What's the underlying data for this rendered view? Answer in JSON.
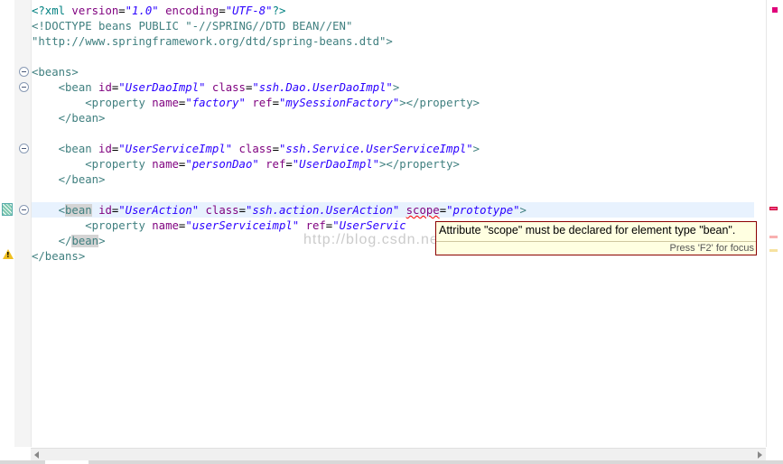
{
  "editor": {
    "lines": [
      {
        "parts": [
          {
            "c": "t-decl",
            "t": "<?xml "
          },
          {
            "c": "t-attr",
            "t": "version"
          },
          {
            "c": "",
            "t": "="
          },
          {
            "c": "t-str",
            "t": "\"1.0\""
          },
          {
            "c": "",
            "t": " "
          },
          {
            "c": "t-attr",
            "t": "encoding"
          },
          {
            "c": "",
            "t": "="
          },
          {
            "c": "t-str",
            "t": "\"UTF-8\""
          },
          {
            "c": "t-decl",
            "t": "?>"
          }
        ]
      },
      {
        "parts": [
          {
            "c": "t-doc",
            "t": "<!DOCTYPE beans PUBLIC \"-//SPRING//DTD BEAN//EN\""
          }
        ]
      },
      {
        "parts": [
          {
            "c": "t-doc",
            "t": "\"http://www.springframework.org/dtd/spring-beans.dtd\">"
          }
        ]
      },
      {
        "parts": []
      },
      {
        "parts": [
          {
            "c": "t-tag",
            "t": "<beans>"
          }
        ]
      },
      {
        "parts": [
          {
            "c": "",
            "t": "    "
          },
          {
            "c": "t-tag",
            "t": "<bean "
          },
          {
            "c": "t-attr",
            "t": "id"
          },
          {
            "c": "",
            "t": "="
          },
          {
            "c": "t-str",
            "t": "\"UserDaoImpl\""
          },
          {
            "c": "",
            "t": " "
          },
          {
            "c": "t-attr",
            "t": "class"
          },
          {
            "c": "",
            "t": "="
          },
          {
            "c": "t-str",
            "t": "\"ssh.Dao.UserDaoImpl\""
          },
          {
            "c": "t-tag",
            "t": ">"
          }
        ]
      },
      {
        "parts": [
          {
            "c": "",
            "t": "        "
          },
          {
            "c": "t-tag",
            "t": "<property "
          },
          {
            "c": "t-attr",
            "t": "name"
          },
          {
            "c": "",
            "t": "="
          },
          {
            "c": "t-str",
            "t": "\"factory\""
          },
          {
            "c": "",
            "t": " "
          },
          {
            "c": "t-attr",
            "t": "ref"
          },
          {
            "c": "",
            "t": "="
          },
          {
            "c": "t-str",
            "t": "\"mySessionFactory\""
          },
          {
            "c": "t-tag",
            "t": "></property>"
          }
        ]
      },
      {
        "parts": [
          {
            "c": "",
            "t": "    "
          },
          {
            "c": "t-tag",
            "t": "</bean>"
          }
        ]
      },
      {
        "parts": []
      },
      {
        "parts": [
          {
            "c": "",
            "t": "    "
          },
          {
            "c": "t-tag",
            "t": "<bean "
          },
          {
            "c": "t-attr",
            "t": "id"
          },
          {
            "c": "",
            "t": "="
          },
          {
            "c": "t-str",
            "t": "\"UserServiceImpl\""
          },
          {
            "c": "",
            "t": " "
          },
          {
            "c": "t-attr",
            "t": "class"
          },
          {
            "c": "",
            "t": "="
          },
          {
            "c": "t-str",
            "t": "\"ssh.Service.UserServiceImpl\""
          },
          {
            "c": "t-tag",
            "t": ">"
          }
        ]
      },
      {
        "parts": [
          {
            "c": "",
            "t": "        "
          },
          {
            "c": "t-tag",
            "t": "<property "
          },
          {
            "c": "t-attr",
            "t": "name"
          },
          {
            "c": "",
            "t": "="
          },
          {
            "c": "t-str",
            "t": "\"personDao\""
          },
          {
            "c": "",
            "t": " "
          },
          {
            "c": "t-attr",
            "t": "ref"
          },
          {
            "c": "",
            "t": "="
          },
          {
            "c": "t-str",
            "t": "\"UserDaoImpl\""
          },
          {
            "c": "t-tag",
            "t": "></property>"
          }
        ]
      },
      {
        "parts": [
          {
            "c": "",
            "t": "    "
          },
          {
            "c": "t-tag",
            "t": "</bean>"
          }
        ]
      },
      {
        "parts": []
      },
      {
        "parts": [
          {
            "c": "",
            "t": "    "
          },
          {
            "c": "t-tag",
            "t": "<"
          },
          {
            "c": "t-tag match",
            "t": "bean"
          },
          {
            "c": "",
            "t": " "
          },
          {
            "c": "t-attr",
            "t": "id"
          },
          {
            "c": "",
            "t": "="
          },
          {
            "c": "t-str",
            "t": "\"UserAction\""
          },
          {
            "c": "",
            "t": " "
          },
          {
            "c": "t-attr",
            "t": "class"
          },
          {
            "c": "",
            "t": "="
          },
          {
            "c": "t-str",
            "t": "\"ssh.action.UserAction\""
          },
          {
            "c": "",
            "t": " "
          },
          {
            "c": "t-attr squiggle",
            "t": "scope"
          },
          {
            "c": "",
            "t": "="
          },
          {
            "c": "t-str",
            "t": "\"prototype\""
          },
          {
            "c": "t-tag",
            "t": ">"
          }
        ]
      },
      {
        "parts": [
          {
            "c": "",
            "t": "        "
          },
          {
            "c": "t-tag",
            "t": "<property "
          },
          {
            "c": "t-attr",
            "t": "name"
          },
          {
            "c": "",
            "t": "="
          },
          {
            "c": "t-str",
            "t": "\"userServiceimpl\""
          },
          {
            "c": "",
            "t": " "
          },
          {
            "c": "t-attr",
            "t": "ref"
          },
          {
            "c": "",
            "t": "="
          },
          {
            "c": "t-str",
            "t": "\"UserServic"
          }
        ]
      },
      {
        "parts": [
          {
            "c": "",
            "t": "    "
          },
          {
            "c": "t-tag",
            "t": "</"
          },
          {
            "c": "t-tag match",
            "t": "bean"
          },
          {
            "c": "t-tag",
            "t": ">"
          }
        ]
      },
      {
        "parts": [
          {
            "c": "t-tag",
            "t": "</beans>"
          }
        ]
      }
    ]
  },
  "tooltip": {
    "message": "Attribute \"scope\" must be declared for element type \"bean\".",
    "hint": "Press 'F2' for focus"
  },
  "watermark": "http://blog.csdn.net/",
  "colors": {
    "tag": "#3f7f7f",
    "attribute": "#7f007f",
    "string": "#2a00ff",
    "current_line": "#e8f2fe",
    "error": "#ff0000",
    "tooltip_bg": "#ffffe1"
  },
  "icons": {
    "error_marker": "error-annotation-icon",
    "warning_marker": "warning-triangle-icon",
    "fold": "fold-collapse-icon"
  }
}
